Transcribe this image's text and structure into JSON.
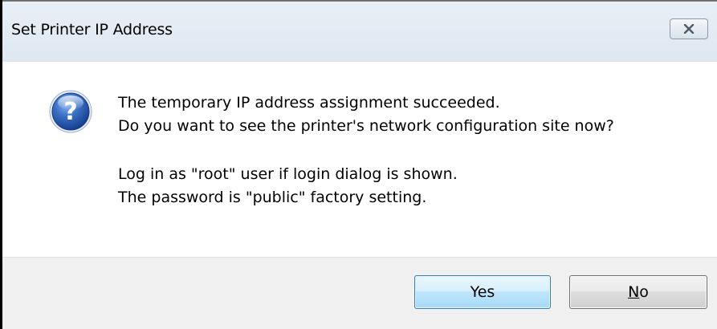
{
  "dialog": {
    "title": "Set Printer IP Address",
    "close_icon": "close-icon",
    "message_icon": "question-icon",
    "message_lines": [
      "The temporary IP address assignment succeeded.",
      "Do you want to see the printer's network configuration site now?",
      "Log in as \"root\" user if login dialog is shown.",
      "The password is \"public\" factory setting."
    ],
    "buttons": {
      "yes_label": "Yes",
      "no_accel": "N",
      "no_rest": "o"
    }
  },
  "colors": {
    "titlebar": "#dde7f1",
    "footer": "#f0f0f0",
    "icon_blue": "#1e4fa3",
    "default_button_border": "#3c7fb1"
  }
}
